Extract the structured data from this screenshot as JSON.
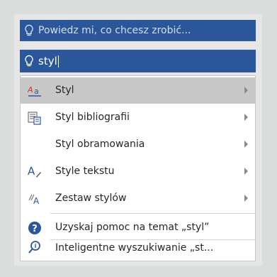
{
  "tell_me": {
    "placeholder": "Powiedz mi, co chcesz zrobić..."
  },
  "search": {
    "value": "styl"
  },
  "menu": {
    "items": [
      {
        "label": "Styl",
        "icon": "styles-icon",
        "submenu": true,
        "highlighted": true
      },
      {
        "label": "Styl bibliografii",
        "icon": "bibliography-icon",
        "submenu": true
      },
      {
        "label": "Styl obramowania",
        "icon": "",
        "submenu": true
      },
      {
        "label": "Style tekstu",
        "icon": "text-effects-icon",
        "submenu": true
      },
      {
        "label": "Zestaw stylów",
        "icon": "style-set-icon",
        "submenu": true
      }
    ],
    "help_label": "Uzyskaj pomoc na temat „styl”",
    "smart_lookup_label": "Inteligentne wyszukiwanie „st..."
  },
  "colors": {
    "accent": "#2b579a",
    "highlight": "#c8c8c8"
  }
}
